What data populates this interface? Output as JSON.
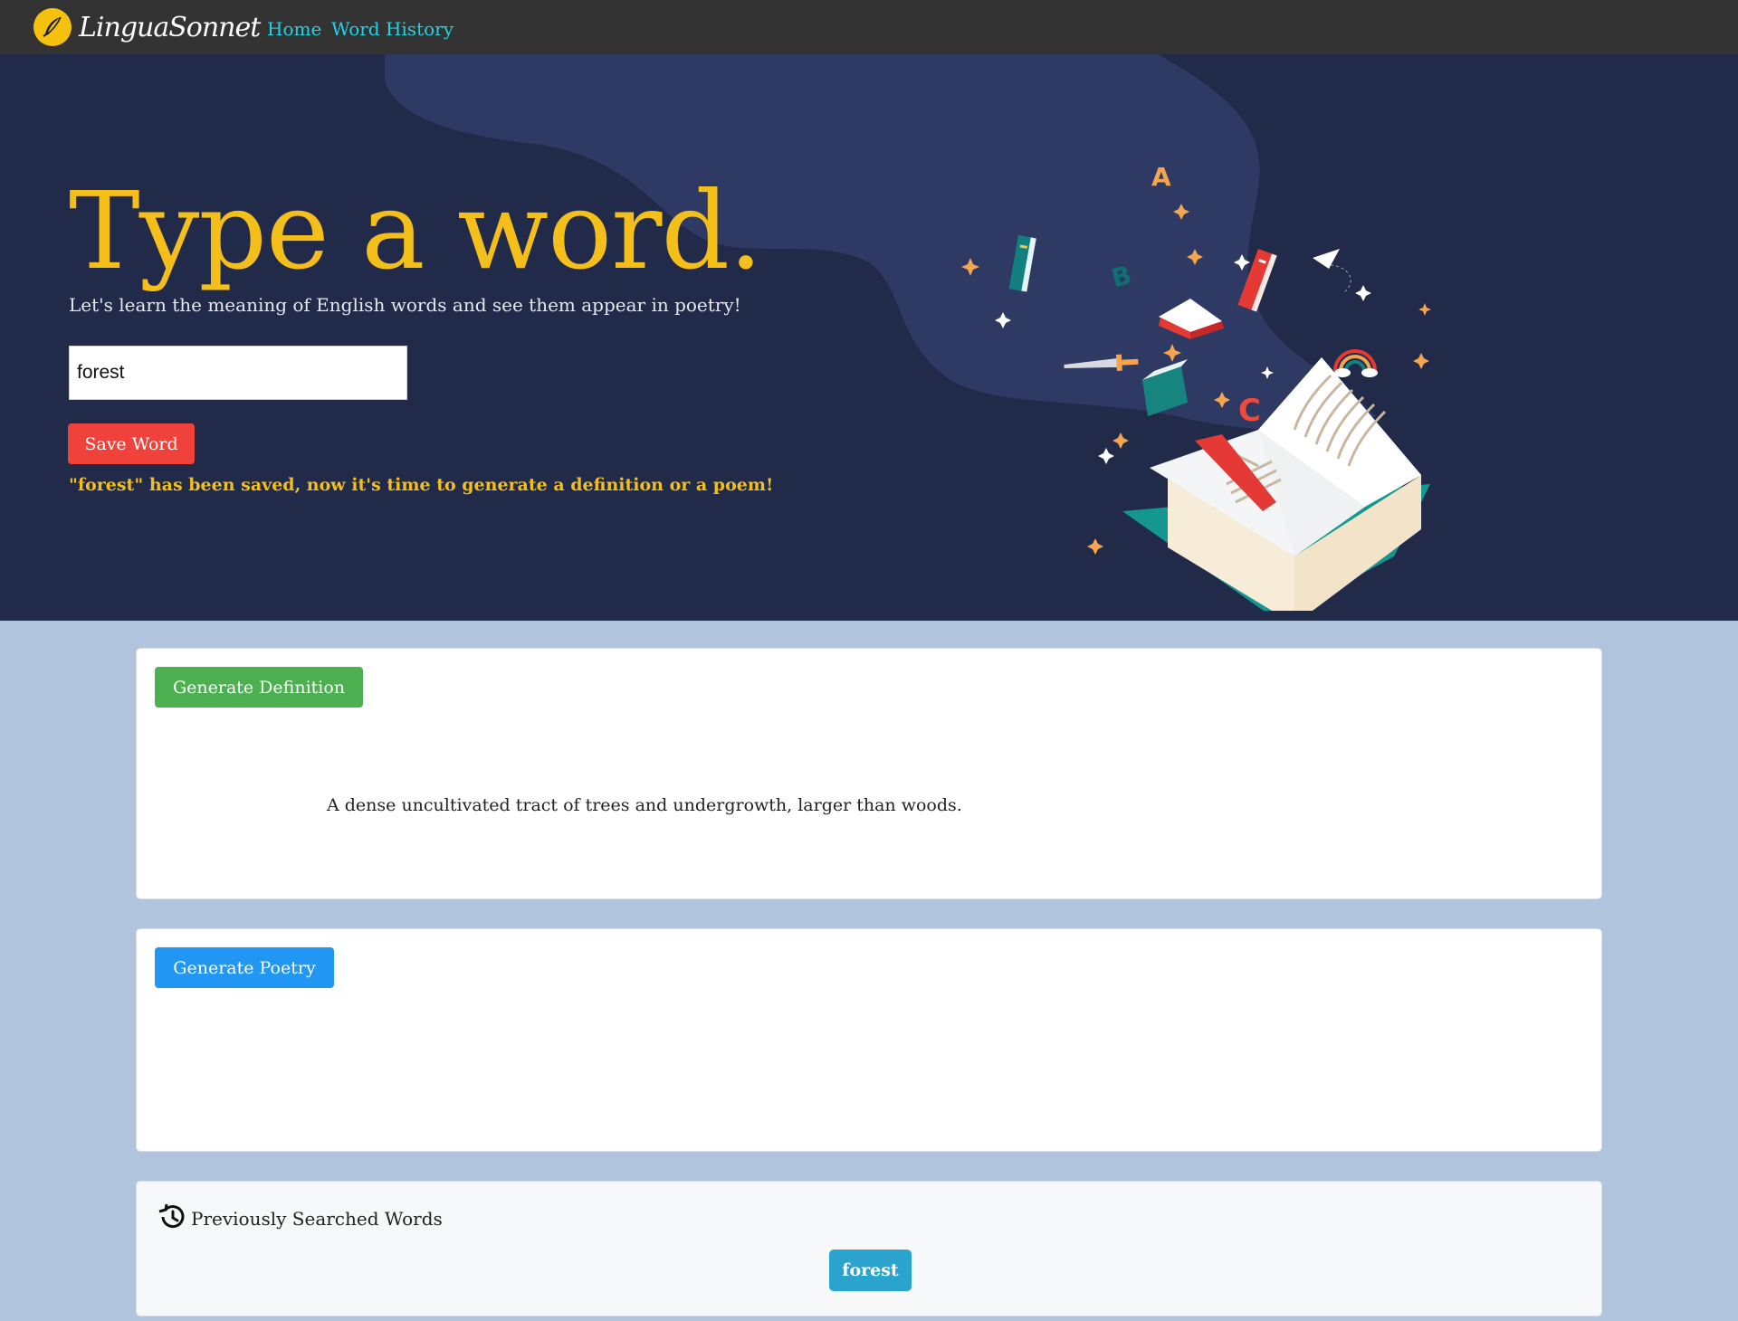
{
  "navbar": {
    "brand": "LinguaSonnet",
    "links": [
      "Home",
      "Word History"
    ]
  },
  "hero": {
    "title": "Type a word.",
    "subtitle": "Let's learn the meaning of English words and see them appear in poetry!",
    "input_value": "forest",
    "save_label": "Save Word",
    "save_message": "\"forest\" has been saved, now it's time to generate a definition or a poem!"
  },
  "definition": {
    "button_label": "Generate Definition",
    "text": "A dense uncultivated tract of trees and undergrowth, larger than woods."
  },
  "poetry": {
    "button_label": "Generate Poetry"
  },
  "history": {
    "title": "Previously Searched Words",
    "words": [
      "forest"
    ]
  },
  "colors": {
    "navbar": "#333333",
    "nav_link": "#1fd3e6",
    "hero_bg": "#212b49",
    "hero_title": "#f4be1b",
    "save_button": "#f0423a",
    "definition_button": "#4cb050",
    "poetry_button": "#2196f3",
    "history_chip": "#2aa4cf",
    "page_bg": "#b0c4de"
  },
  "icons": {
    "brand": "quill-pen-icon",
    "history": "history-clock-icon",
    "illustration": "open-book-illustration"
  }
}
